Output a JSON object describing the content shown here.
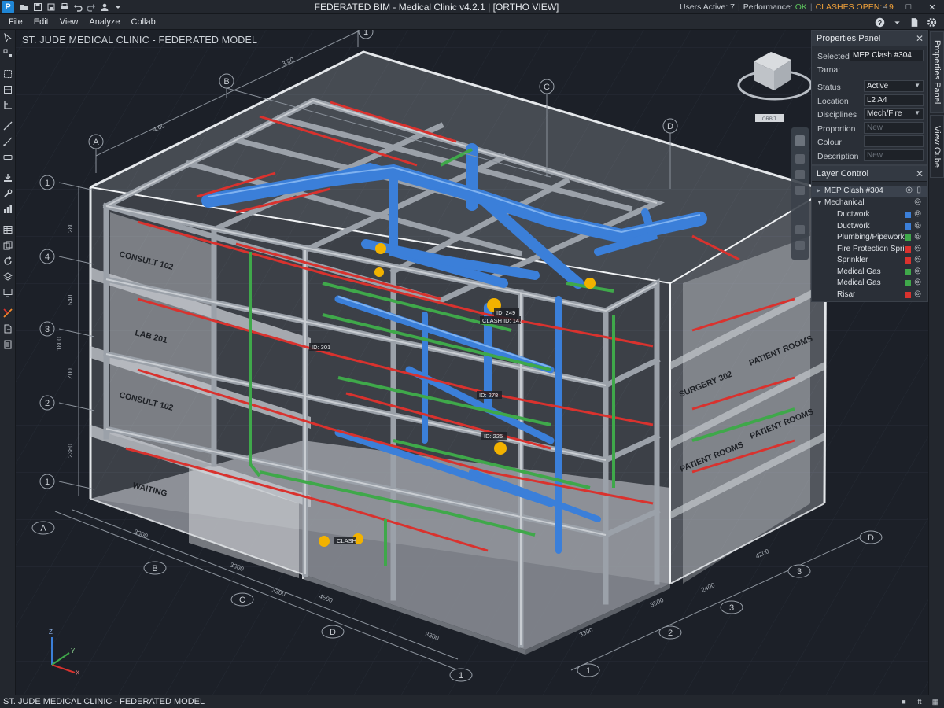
{
  "window": {
    "title": "FEDERATED BIM - Medical Clinic v4.2.1 | [ORTHO VIEW]",
    "users_active": "Users Active: 7",
    "performance_label": "Performance:",
    "performance_value": "OK",
    "clashes_open": "CLASHES OPEN: 19",
    "app_icon": "P"
  },
  "menu": {
    "file": "File",
    "edit": "Edit",
    "view": "View",
    "analyze": "Analyze",
    "collab": "Collab"
  },
  "viewport": {
    "model_title": "ST. JUDE MEDICAL CLINIC - FEDERATED MODEL",
    "view_cube_label": "ORBIT",
    "room_labels": {
      "consult_upper": "CONSULT 102",
      "lab": "LAB 201",
      "consult_lower": "CONSULT 102",
      "waiting": "WAITING",
      "surgery": "SURGERY 302",
      "patient_rooms_1": "PATIENT ROOMS",
      "patient_rooms_2": "PATIENT ROOMS",
      "patient_rooms_3": "PATIENT ROOMS"
    },
    "clash_tags": {
      "id301": "ID: 301",
      "id249": "ID: 249",
      "clash147": "CLASH ID: 147",
      "id278": "ID: 278",
      "id225": "ID: 225",
      "clash": "CLASH"
    },
    "grid_bubbles": {
      "top_a": "A",
      "top_b": "B",
      "top_c": "C",
      "top_d": "D",
      "top_1": "1",
      "left_1a": "1",
      "left_4": "4",
      "left_3": "3",
      "left_2": "2",
      "left_1b": "1",
      "bot_a": "A",
      "bot_b": "B",
      "bot_c": "C",
      "bot_d": "D",
      "bot_1": "1",
      "right_d": "D",
      "right_3": "3",
      "right_2": "2",
      "right_1": "1"
    },
    "dimensions": {
      "top_380": "3.80",
      "top_400": "4.00",
      "left_280": "280",
      "left_540": "540",
      "left_1800": "1800",
      "left_700": "Z00",
      "left_2380": "2380",
      "bot_3300a": "3300",
      "bot_3300b": "3300",
      "bot_4500": "4500",
      "bot_3300c": "3300",
      "bot_3300d": "3300",
      "right_4200": "4200",
      "right_2400": "2400",
      "right_3500": "3500",
      "right_3300": "3300"
    },
    "axes": {
      "x": "X",
      "y": "Y",
      "z": "Z"
    }
  },
  "properties_panel": {
    "title": "Properties Panel",
    "selected_label": "Selected:",
    "selected_value": "MEP Clash #304",
    "tabs_label": "Tarna:",
    "rows": [
      {
        "key": "Status",
        "value": "Active",
        "dropdown": true,
        "placeholder": false
      },
      {
        "key": "Location",
        "value": "L2 A4",
        "dropdown": false,
        "placeholder": false
      },
      {
        "key": "Disciplines",
        "value": "Mech/Fire",
        "dropdown": true,
        "placeholder": false
      },
      {
        "key": "Proportion",
        "value": "New",
        "dropdown": false,
        "placeholder": true
      },
      {
        "key": "Colour",
        "value": "",
        "dropdown": false,
        "placeholder": false
      },
      {
        "key": "Description",
        "value": "New",
        "dropdown": false,
        "placeholder": true
      }
    ]
  },
  "layer_control": {
    "title": "Layer Control",
    "clash_item": "MEP Clash #304",
    "group": "Mechanical",
    "layers": [
      {
        "name": "Ductwork",
        "color": "#3b7fd9"
      },
      {
        "name": "Ductwork",
        "color": "#3b7fd9"
      },
      {
        "name": "Plumbing/Pipework",
        "color": "#3fa84a"
      },
      {
        "name": "Fire Protection Spri...",
        "color": "#d9322e"
      },
      {
        "name": "Sprinkler",
        "color": "#d9322e"
      },
      {
        "name": "Medical Gas",
        "color": "#3fa84a"
      },
      {
        "name": "Medical Gas",
        "color": "#3fa84a"
      },
      {
        "name": "Risar",
        "color": "#d9322e"
      }
    ]
  },
  "right_tabs": {
    "properties": "Properties Panel",
    "view_cube": "View Cube"
  },
  "status_bar": {
    "text": "ST. JUDE MEDICAL CLINIC - FEDERATED MODEL",
    "unit": "ft"
  },
  "colors": {
    "duct": "#3b7fd9",
    "pipe_green": "#3fa84a",
    "pipe_red": "#d9322e",
    "clash": "#f2b200",
    "ok": "#5ec75e",
    "warn": "#f2a23a"
  }
}
